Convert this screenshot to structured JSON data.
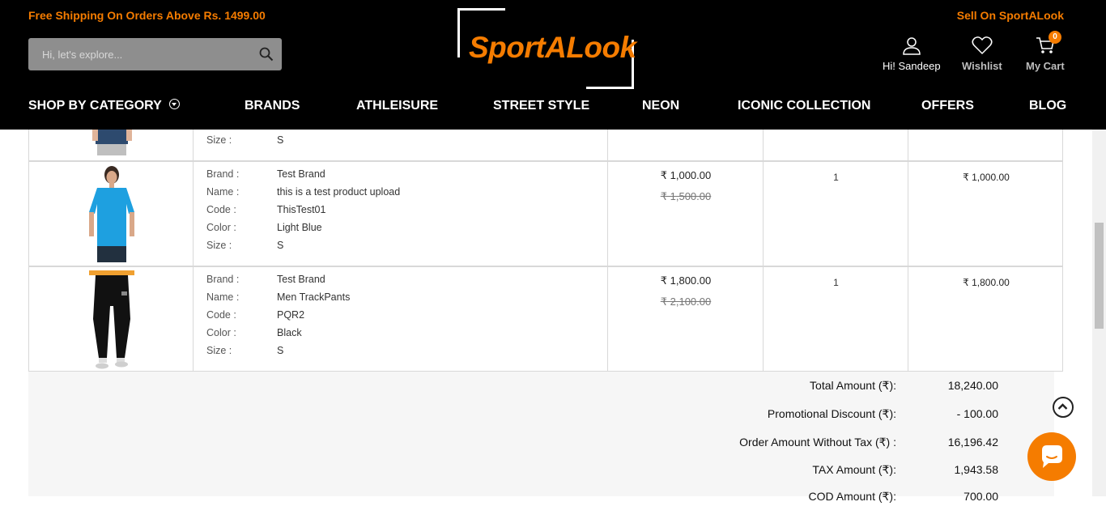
{
  "header": {
    "promo": "Free Shipping On Orders Above Rs. 1499.00",
    "sell": "Sell On SportALook",
    "search_placeholder": "Hi, let's explore...",
    "logo": "SportALook",
    "user_label": "Hi! Sandeep",
    "wishlist_label": "Wishlist",
    "cart_label": "My Cart",
    "cart_count": "0"
  },
  "nav": [
    "SHOP BY CATEGORY",
    "BRANDS",
    "ATHLEISURE",
    "STREET STYLE",
    "NEON",
    "ICONIC COLLECTION",
    "OFFERS",
    "BLOG"
  ],
  "labels": {
    "brand": "Brand :",
    "name": "Name :",
    "code": "Code :",
    "color": "Color :",
    "size": "Size :"
  },
  "items": [
    {
      "size": "S"
    },
    {
      "brand": "Test Brand",
      "name": "this is a test product upload",
      "code": "ThisTest01",
      "color": "Light Blue",
      "size": "S",
      "price": "₹ 1,000.00",
      "mrp": "₹ 1,500.00",
      "qty": "1",
      "total": "₹ 1,000.00"
    },
    {
      "brand": "Test Brand",
      "name": "Men TrackPants",
      "code": "PQR2",
      "color": "Black",
      "size": "S",
      "price": "₹ 1,800.00",
      "mrp": "₹ 2,100.00",
      "qty": "1",
      "total": "₹ 1,800.00"
    }
  ],
  "summary": [
    {
      "label": "Total Amount (₹):",
      "value": "18,240.00"
    },
    {
      "label": "Promotional Discount (₹):",
      "value": "- 100.00"
    },
    {
      "label": "Order Amount Without Tax (₹) :",
      "value": "16,196.42"
    },
    {
      "label": "TAX Amount (₹):",
      "value": "1,943.58"
    },
    {
      "label": "COD Amount (₹):",
      "value": "700.00"
    }
  ],
  "colors": {
    "accent": "#f57c00",
    "header_bg": "#000000"
  }
}
